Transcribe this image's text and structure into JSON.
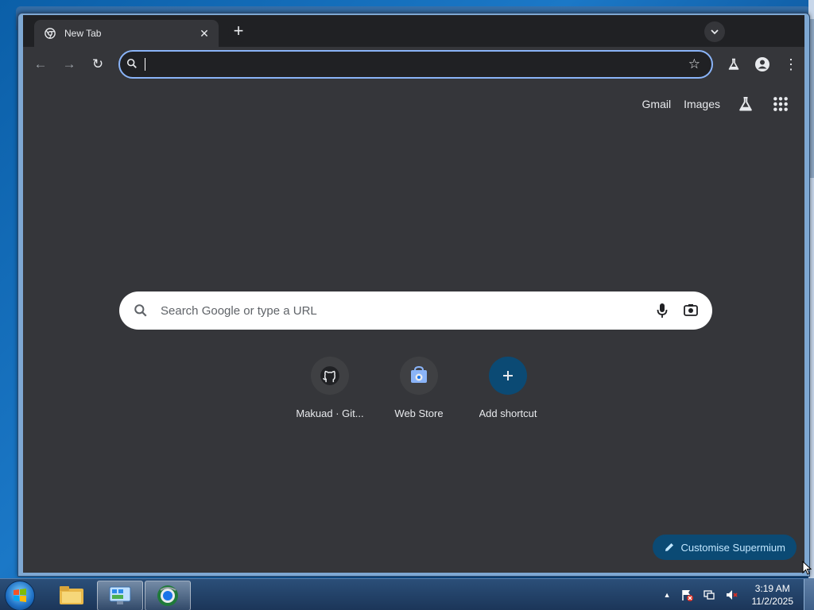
{
  "window": {
    "tab_title": "New Tab",
    "minimize": "—",
    "maximize": "❐",
    "close": "✕"
  },
  "tabstrip": {
    "new_tab_symbol": "+",
    "tab_search_symbol": "⌄",
    "tab_close_symbol": "✕"
  },
  "toolbar": {
    "back_symbol": "←",
    "forward_symbol": "→",
    "reload_symbol": "↻",
    "omnibox_value": "",
    "bookmark_symbol": "☆",
    "menu_symbol": "⋮"
  },
  "ntp": {
    "gmail_label": "Gmail",
    "images_label": "Images",
    "search_placeholder": "Search Google or type a URL",
    "shortcuts": [
      {
        "label": "Makuad · Git...",
        "icon": "github-icon"
      },
      {
        "label": "Web Store",
        "icon": "webstore-icon"
      },
      {
        "label": "Add shortcut",
        "icon": "plus-icon"
      }
    ],
    "customise_label": "Customise Supermium"
  },
  "taskbar": {
    "time": "3:19 AM",
    "date": "11/2/2025",
    "tray_up_symbol": "▲"
  },
  "colors": {
    "tab_active_bg": "#35363a",
    "frame_bg": "#202124",
    "accent_blue": "#8ab4f8",
    "customise_bg": "#0b4a74"
  }
}
